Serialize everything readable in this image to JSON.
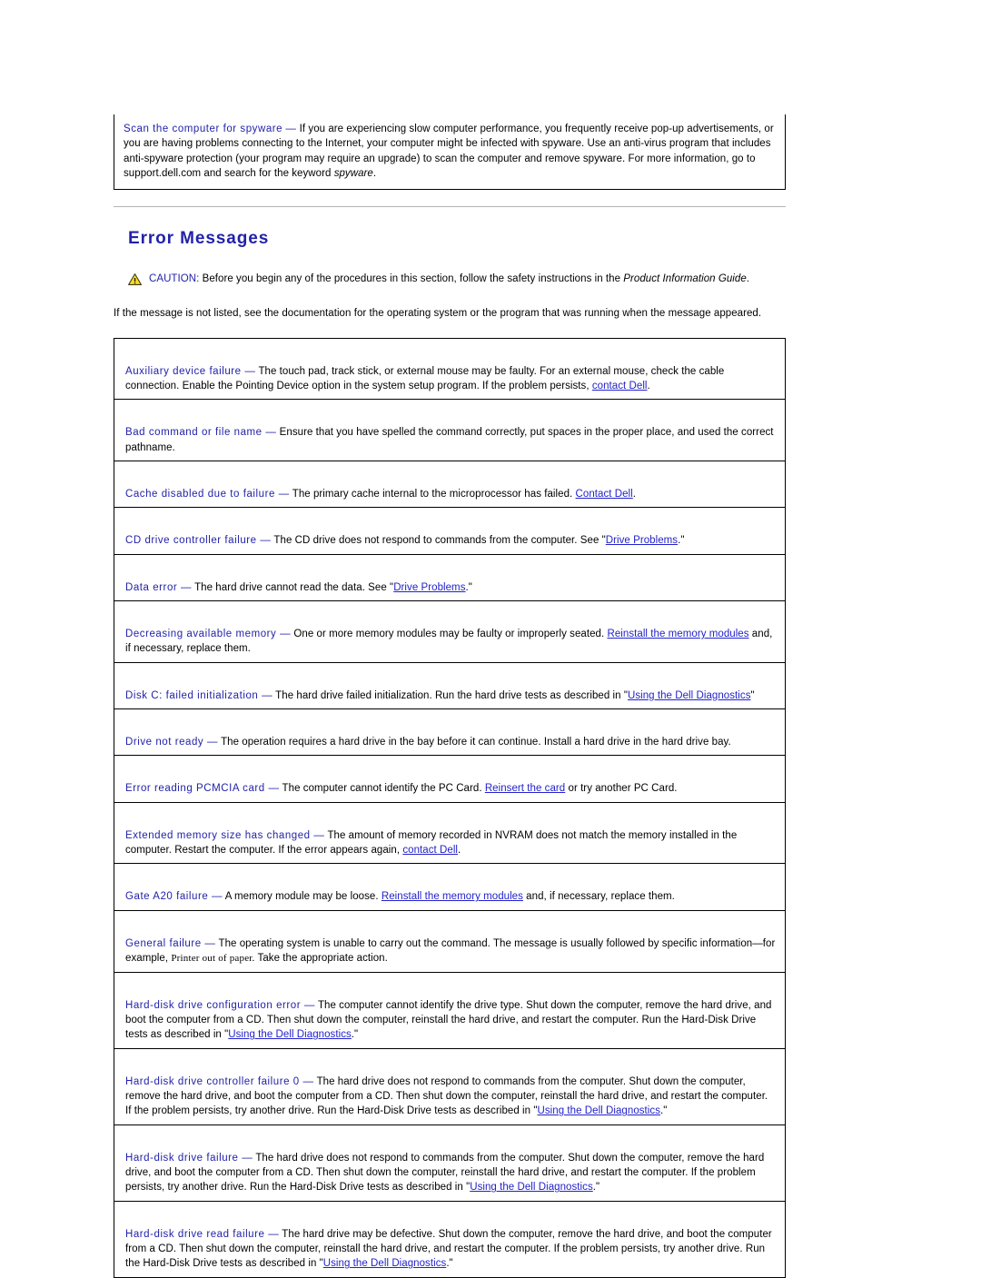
{
  "callout": {
    "term": "Scan the computer for spyware",
    "dash": "—",
    "body_1": " If you are experiencing slow computer performance, you frequently receive pop-up advertisements, or you are having problems connecting to the Internet, your computer might be infected with spyware. Use an anti-virus program that includes anti-spyware protection (your program may require an upgrade) to scan the computer and remove spyware. For more information, go to support.dell.com and search for the keyword ",
    "keyword": "spyware",
    "body_2": "."
  },
  "section": {
    "title": "Error Messages"
  },
  "caution": {
    "icon": "warning-triangle-icon",
    "label": "CAUTION:",
    "body_1": " Before you begin any of the procedures in this section, follow the safety instructions in the ",
    "italic": "Product Information Guide",
    "body_2": "."
  },
  "intro": "If the message is not listed, see the documentation for the operating system or the program that was running when the message appeared.",
  "colors": {
    "term_blue": "#2222aa",
    "link_blue": "#2222cc",
    "heading_blue": "#2222aa",
    "rule_gray": "#b4b4b4",
    "caution_triangle": "#ffdd22",
    "border_black": "#000000"
  },
  "messages": [
    {
      "term": "Auxiliary device failure",
      "dash": "—",
      "parts": [
        {
          "type": "text",
          "value": " The touch pad, track stick, or external mouse may be faulty. For an external mouse, check the cable connection. Enable the Pointing Device option in the system setup program. If the problem persists, "
        },
        {
          "type": "link",
          "value": "contact Dell"
        },
        {
          "type": "text",
          "value": "."
        }
      ]
    },
    {
      "term": "Bad command or file name",
      "dash": "—",
      "parts": [
        {
          "type": "text",
          "value": " Ensure that you have spelled the command correctly, put spaces in the proper place, and used the correct pathname."
        }
      ]
    },
    {
      "term": "Cache disabled due to failure",
      "dash": "—",
      "parts": [
        {
          "type": "text",
          "value": " The primary cache internal to the microprocessor has failed. "
        },
        {
          "type": "link",
          "value": "Contact Dell"
        },
        {
          "type": "text",
          "value": "."
        }
      ]
    },
    {
      "term": "CD drive controller failure",
      "dash": "—",
      "parts": [
        {
          "type": "text",
          "value": " The CD drive does not respond to commands from the computer. See \""
        },
        {
          "type": "link",
          "value": "Drive Problems"
        },
        {
          "type": "text",
          "value": ".\""
        }
      ]
    },
    {
      "term": "Data error",
      "dash": "—",
      "parts": [
        {
          "type": "text",
          "value": " The hard drive cannot read the data. See \""
        },
        {
          "type": "link",
          "value": "Drive Problems"
        },
        {
          "type": "text",
          "value": ".\""
        }
      ]
    },
    {
      "term": "Decreasing available memory",
      "dash": "—",
      "parts": [
        {
          "type": "text",
          "value": " One or more memory modules may be faulty or improperly seated. "
        },
        {
          "type": "link",
          "value": "Reinstall the memory modules"
        },
        {
          "type": "text",
          "value": " and, if necessary, replace them."
        }
      ]
    },
    {
      "term": "Disk C: failed initialization",
      "dash": "—",
      "parts": [
        {
          "type": "text",
          "value": " The hard drive failed initialization. Run the hard drive tests as described in \""
        },
        {
          "type": "link",
          "value": "Using the Dell Diagnostics"
        },
        {
          "type": "text",
          "value": "\""
        }
      ]
    },
    {
      "term": "Drive not ready",
      "dash": "—",
      "parts": [
        {
          "type": "text",
          "value": " The operation requires a hard drive in the bay before it can continue. Install a hard drive in the hard drive bay."
        }
      ]
    },
    {
      "term": "Error reading PCMCIA card",
      "dash": "—",
      "parts": [
        {
          "type": "text",
          "value": " The computer cannot identify the PC Card. "
        },
        {
          "type": "link",
          "value": "Reinsert the card"
        },
        {
          "type": "text",
          "value": " or try another PC Card."
        }
      ]
    },
    {
      "term": "Extended memory size has changed",
      "dash": "—",
      "parts": [
        {
          "type": "text",
          "value": " The amount of memory recorded in NVRAM does not match the memory installed in the computer. Restart the computer. If the error appears again, "
        },
        {
          "type": "link",
          "value": "contact Dell"
        },
        {
          "type": "text",
          "value": "."
        }
      ]
    },
    {
      "term": "Gate A20 failure",
      "dash": "—",
      "parts": [
        {
          "type": "text",
          "value": " A memory module may be loose. "
        },
        {
          "type": "link",
          "value": "Reinstall the memory modules"
        },
        {
          "type": "text",
          "value": " and, if necessary, replace them."
        }
      ]
    },
    {
      "term": "General failure",
      "dash": "—",
      "parts": [
        {
          "type": "text",
          "value": " The operating system is unable to carry out the command. The message is usually followed by specific information—for example, "
        },
        {
          "type": "mono",
          "value": "Printer out of paper."
        },
        {
          "type": "text",
          "value": " Take the appropriate action."
        }
      ]
    },
    {
      "term": "Hard-disk drive configuration error",
      "dash": "—",
      "parts": [
        {
          "type": "text",
          "value": " The computer cannot identify the drive type. Shut down the computer, remove the hard drive, and boot the computer from a CD. Then shut down the computer, reinstall the hard drive, and restart the computer. Run the Hard-Disk Drive tests as described in \""
        },
        {
          "type": "link",
          "value": "Using the Dell Diagnostics"
        },
        {
          "type": "text",
          "value": ".\""
        }
      ]
    },
    {
      "term": "Hard-disk drive controller failure 0",
      "dash": "—",
      "parts": [
        {
          "type": "text",
          "value": " The hard drive does not respond to commands from the computer. Shut down the computer, remove the hard drive, and boot the computer from a CD. Then shut down the computer, reinstall the hard drive, and restart the computer. If the problem persists, try another drive. Run the Hard-Disk Drive tests as described in \""
        },
        {
          "type": "link",
          "value": "Using the Dell Diagnostics"
        },
        {
          "type": "text",
          "value": ".\""
        }
      ]
    },
    {
      "term": "Hard-disk drive failure",
      "dash": "—",
      "parts": [
        {
          "type": "text",
          "value": " The hard drive does not respond to commands from the computer. Shut down the computer, remove the hard drive, and boot the computer from a CD. Then shut down the computer, reinstall the hard drive, and restart the computer. If the problem persists, try another drive. Run the Hard-Disk Drive tests as described in \""
        },
        {
          "type": "link",
          "value": "Using the Dell Diagnostics"
        },
        {
          "type": "text",
          "value": ".\""
        }
      ]
    },
    {
      "term": "Hard-disk drive read failure",
      "dash": "—",
      "parts": [
        {
          "type": "text",
          "value": " The hard drive may be defective. Shut down the computer, remove the hard drive, and boot the computer from a CD. Then shut down the computer, reinstall the hard drive, and restart the computer. If the problem persists, try another drive. Run the Hard-Disk Drive tests as described in \""
        },
        {
          "type": "link",
          "value": "Using the Dell Diagnostics"
        },
        {
          "type": "text",
          "value": ".\""
        }
      ]
    }
  ]
}
